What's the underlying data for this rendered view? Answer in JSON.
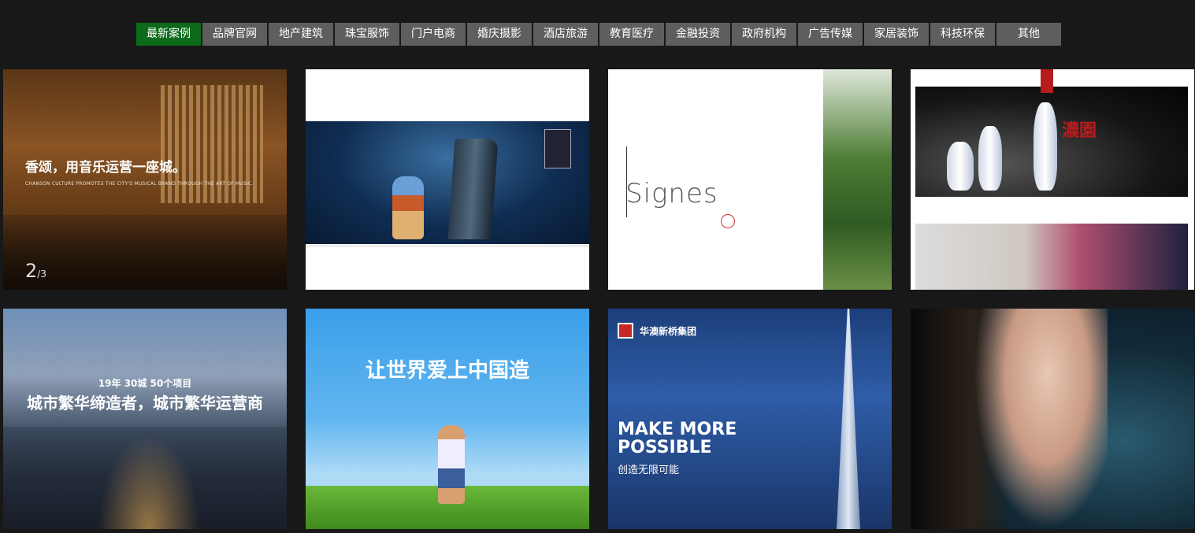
{
  "tabs": [
    {
      "label": "最新案例",
      "active": true
    },
    {
      "label": "品牌官网"
    },
    {
      "label": "地产建筑"
    },
    {
      "label": "珠宝服饰"
    },
    {
      "label": "门户电商"
    },
    {
      "label": "婚庆摄影"
    },
    {
      "label": "酒店旅游"
    },
    {
      "label": "教育医疗"
    },
    {
      "label": "金融投资"
    },
    {
      "label": "政府机构"
    },
    {
      "label": "广告传媒"
    },
    {
      "label": "家居装饰"
    },
    {
      "label": "科技环保"
    },
    {
      "label": "其他"
    }
  ],
  "colors": {
    "active_tab": "#0b6b1a",
    "tab": "#5e5e5e",
    "background": "#181818"
  },
  "cards": {
    "c1": {
      "headline": "香颂，用音乐运营一座城。",
      "subline": "CHANSON CULTURE PROMOTES THE CITY'S MUSICAL BRAND THROUGH THE ART OF MUSIC.",
      "pager_current": "2",
      "pager_total": "/3"
    },
    "c3": {
      "word": "Signes"
    },
    "c4": {
      "title": "濃園"
    },
    "c5": {
      "line1": "19年 30城 50个项目",
      "line2": "城市繁华缔造者，城市繁华运营商"
    },
    "c6": {
      "calligraphy": "让世界爱上中国造"
    },
    "c7": {
      "brand": "华澳新桥集团",
      "slogan_line1": "MAKE MORE",
      "slogan_line2": "POSSIBLE",
      "slogan_cn": "创造无限可能"
    }
  }
}
